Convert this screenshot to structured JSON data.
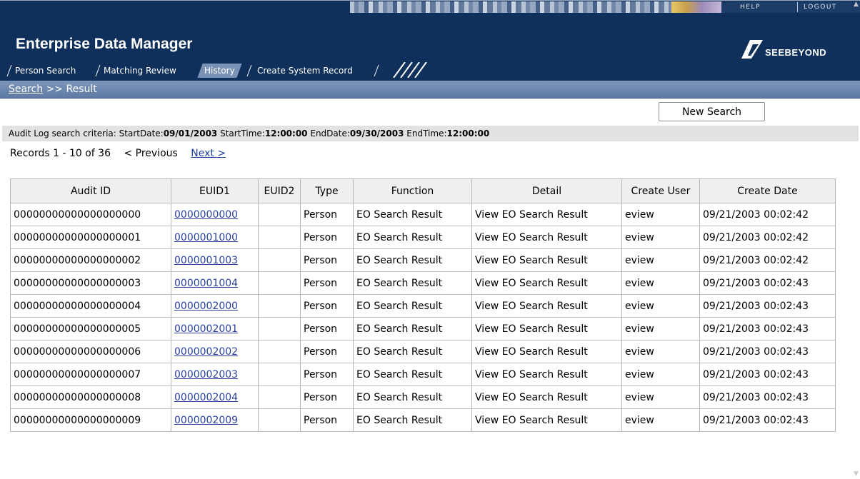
{
  "header": {
    "app_title": "Enterprise Data Manager",
    "help_label": "HELP",
    "logout_label": "LOGOUT",
    "logo_text": "SEEBEYOND",
    "brand_color": "#10305c"
  },
  "tabs": [
    {
      "label": "Person Search",
      "active": false
    },
    {
      "label": "Matching Review",
      "active": false
    },
    {
      "label": "History",
      "active": true
    },
    {
      "label": "Create System Record",
      "active": false
    }
  ],
  "breadcrumb": {
    "link": "Search",
    "separator": ">>",
    "current": "Result"
  },
  "new_search_label": "New Search",
  "criteria": {
    "prefix": "Audit Log search criteria:",
    "start_date_label": "StartDate:",
    "start_date": "09/01/2003",
    "start_time_label": "StartTime:",
    "start_time": "12:00:00",
    "end_date_label": "EndDate:",
    "end_date": "09/30/2003",
    "end_time_label": "EndTime:",
    "end_time": "12:00:00"
  },
  "pager": {
    "records": "Records 1 - 10 of 36",
    "previous": "< Previous",
    "next": "Next >"
  },
  "table": {
    "columns": [
      "Audit ID",
      "EUID1",
      "EUID2",
      "Type",
      "Function",
      "Detail",
      "Create User",
      "Create Date"
    ],
    "rows": [
      {
        "audit_id": "00000000000000000000",
        "euid1": "0000000000",
        "euid2": "",
        "type": "Person",
        "function": "EO Search Result",
        "detail": "View EO Search Result",
        "user": "eview",
        "date": "09/21/2003 00:02:42"
      },
      {
        "audit_id": "00000000000000000001",
        "euid1": "0000001000",
        "euid2": "",
        "type": "Person",
        "function": "EO Search Result",
        "detail": "View EO Search Result",
        "user": "eview",
        "date": "09/21/2003 00:02:42"
      },
      {
        "audit_id": "00000000000000000002",
        "euid1": "0000001003",
        "euid2": "",
        "type": "Person",
        "function": "EO Search Result",
        "detail": "View EO Search Result",
        "user": "eview",
        "date": "09/21/2003 00:02:42"
      },
      {
        "audit_id": "00000000000000000003",
        "euid1": "0000001004",
        "euid2": "",
        "type": "Person",
        "function": "EO Search Result",
        "detail": "View EO Search Result",
        "user": "eview",
        "date": "09/21/2003 00:02:43"
      },
      {
        "audit_id": "00000000000000000004",
        "euid1": "0000002000",
        "euid2": "",
        "type": "Person",
        "function": "EO Search Result",
        "detail": "View EO Search Result",
        "user": "eview",
        "date": "09/21/2003 00:02:43"
      },
      {
        "audit_id": "00000000000000000005",
        "euid1": "0000002001",
        "euid2": "",
        "type": "Person",
        "function": "EO Search Result",
        "detail": "View EO Search Result",
        "user": "eview",
        "date": "09/21/2003 00:02:43"
      },
      {
        "audit_id": "00000000000000000006",
        "euid1": "0000002002",
        "euid2": "",
        "type": "Person",
        "function": "EO Search Result",
        "detail": "View EO Search Result",
        "user": "eview",
        "date": "09/21/2003 00:02:43"
      },
      {
        "audit_id": "00000000000000000007",
        "euid1": "0000002003",
        "euid2": "",
        "type": "Person",
        "function": "EO Search Result",
        "detail": "View EO Search Result",
        "user": "eview",
        "date": "09/21/2003 00:02:43"
      },
      {
        "audit_id": "00000000000000000008",
        "euid1": "0000002004",
        "euid2": "",
        "type": "Person",
        "function": "EO Search Result",
        "detail": "View EO Search Result",
        "user": "eview",
        "date": "09/21/2003 00:02:43"
      },
      {
        "audit_id": "00000000000000000009",
        "euid1": "0000002009",
        "euid2": "",
        "type": "Person",
        "function": "EO Search Result",
        "detail": "View EO Search Result",
        "user": "eview",
        "date": "09/21/2003 00:02:43"
      }
    ]
  }
}
